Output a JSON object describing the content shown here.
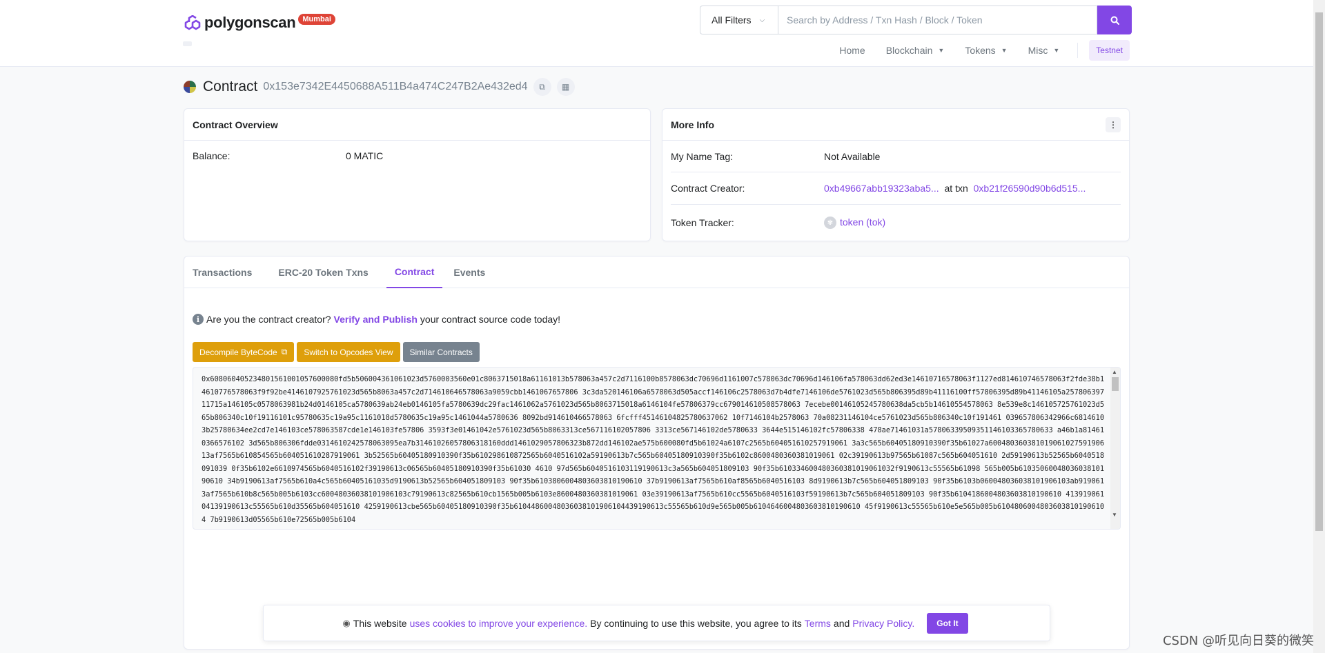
{
  "header": {
    "logo_text": "polygonscan",
    "network_badge": "Mumbai",
    "filter_label": "All Filters",
    "search_placeholder": "Search by Address / Txn Hash / Block / Token",
    "nav": [
      {
        "label": "Home"
      },
      {
        "label": "Blockchain"
      },
      {
        "label": "Tokens"
      },
      {
        "label": "Misc"
      }
    ],
    "testnet_label": "Testnet"
  },
  "page": {
    "title": "Contract",
    "address": "0x153e7342E4450688A511B4a474C247B2Ae432ed4"
  },
  "overview": {
    "header": "Contract Overview",
    "balance_label": "Balance:",
    "balance_value": "0 MATIC"
  },
  "more_info": {
    "header": "More Info",
    "name_tag_label": "My Name Tag:",
    "name_tag_value": "Not Available",
    "creator_label": "Contract Creator:",
    "creator_address": "0xb49667abb19323aba5...",
    "at_txn_label": "at txn",
    "creator_txn": "0xb21f26590d90b6d515...",
    "token_tracker_label": "Token Tracker:",
    "token_tracker_value": "token (tok)"
  },
  "tabs": [
    {
      "label": "Transactions",
      "active": false
    },
    {
      "label": "ERC-20 Token Txns",
      "active": false
    },
    {
      "label": "Contract",
      "active": true
    },
    {
      "label": "Events",
      "active": false
    }
  ],
  "contract_tab": {
    "notice_prefix": "Are you the contract creator?",
    "notice_link": "Verify and Publish",
    "notice_suffix": "your contract source code today!",
    "btn_decompile": "Decompile ByteCode",
    "btn_opcodes": "Switch to Opcodes View",
    "btn_similar": "Similar Contracts",
    "bytecode": "0x608060405234801561001057600080fd5b506004361061023d5760003560e01c8063715018a61161013b578063a457c2d7116100b8578063dc70696d1161007c578063dc70696d146106fa578063dd62ed3e14610716578063f1127ed814610746578063f2fde38b14610776578063f9f92be4146107925761023d565b8063a457c2d714610646578063a9059cbb1461067657806 3c3da520146106a6578063d505accf146106c2578063d7b4dfe7146106de5761023d565b806395d89b41116100ff57806395d89b41146105a25780639711715a146105c0578063981b24d0146105ca5780639ab24eb0146105fa5780639dc29fac1461062a5761023d565b8063715018a6146104fe57806379cc679014610508578063 7ecebe00146105245780638da5cb5b14610554578063 8e539e8c146105725761023d565b806340c10f19116101c95780635c19a95c1161018d5780635c19a95c1461044a5780636 8092bd914610466578063 6fcfff45146104825780637062 10f7146104b2578063 70a08231146104ce5761023d565b806340c10f191461 039657806342966c68146103b25780634ee2cd7e146103ce578063587cde1e146103fe57806 3593f3e01461042e5761023d565b8063313ce567116102057806 3313ce567146102de5780633 3644e515146102fc57806338 478ae71461031a57806339509351146103365780633 a46b1a814610366576102 3d565b806306fdde0314610242578063095ea7b31461026057806318160ddd1461029057806323b872dd146102ae575b600080fd5b61024a6107c2565b604051610257919061 3a3c565b60405180910390f35b61027a600480360381019061027591906 13af7565b610854565b604051610287919061 3b52565b60405180910390f35b610298610872565b6040516102a59190613b7c565b60405180910390f35b6102c8600480360381019061 02c39190613b97565b61087c565b604051610 2d59190613b52565b6040518091039 0f35b6102e6610974565b6040516102f39190613c06565b60405180910390f35b61030 4610 97d565b6040516103119190613c3a565b604051809103 90f35b610334600480360381019061032f9190613c55565b61098 565b005b6103506004803603810190610 34b9190613af7565b610a4c565b60405161035d9190613b52565b604051809103 90f35b6103806004803603810190610 37b9190613af7565b610af8565b6040516103 8d9190613b7c565b604051809103 90f35b6103b060048036038101906103ab9190613af7565b610b8c565b005b6103cc60048036038101906103c79190613c82565b610cb1565b005b6103e8600480360381019061 03e39190613af7565b610cc5565b6040516103f59190613b7c565b604051809103 90f35b6104186004803603810190610 41391906104139190613c55565b610d35565b604051610 4259190613cbe565b60405180910390f35b61044860048036038101906104439190613c55565b610d9e565b005b6104646004803603810190610 45f9190613c55565b610e5e565b005b61048060048036038101906104 7b9190613d05565b610e72565b005b6104"
  },
  "cookie": {
    "text_1": "This website",
    "link_1": "uses cookies to improve your experience.",
    "text_2": "By continuing to use this website, you agree to its",
    "link_2": "Terms",
    "text_3": "and",
    "link_3": "Privacy Policy.",
    "button": "Got It"
  },
  "watermark": "CSDN @听见向日葵的微笑"
}
